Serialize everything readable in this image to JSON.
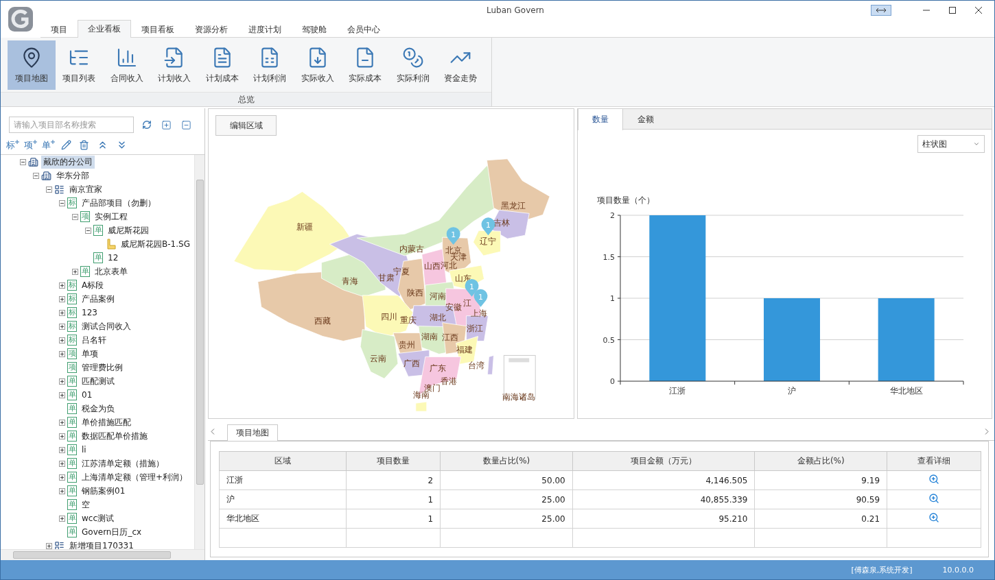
{
  "window": {
    "title": "Luban Govern"
  },
  "menu_tabs": [
    {
      "label": "项目",
      "selected": false
    },
    {
      "label": "企业看板",
      "selected": true
    },
    {
      "label": "项目看板",
      "selected": false
    },
    {
      "label": "资源分析",
      "selected": false
    },
    {
      "label": "进度计划",
      "selected": false
    },
    {
      "label": "驾驶舱",
      "selected": false
    },
    {
      "label": "会员中心",
      "selected": false
    }
  ],
  "ribbon": {
    "group": "总览",
    "buttons": [
      {
        "label": "项目地图",
        "kind": "map",
        "selected": true
      },
      {
        "label": "项目列表",
        "kind": "tree",
        "selected": false
      },
      {
        "label": "合同收入",
        "kind": "chart",
        "selected": false
      },
      {
        "label": "计划收入",
        "kind": "income",
        "selected": false
      },
      {
        "label": "计划成本",
        "kind": "cost",
        "selected": false
      },
      {
        "label": "计划利润",
        "kind": "sheet",
        "selected": false
      },
      {
        "label": "实际收入",
        "kind": "down",
        "selected": false
      },
      {
        "label": "实际成本",
        "kind": "doc",
        "selected": false
      },
      {
        "label": "实际利润",
        "kind": "coins",
        "selected": false
      },
      {
        "label": "资金走势",
        "kind": "trend",
        "selected": false
      }
    ]
  },
  "tree_panel": {
    "search": {
      "placeholder": "请输入项目部名称搜索"
    },
    "tools": [
      {
        "kind": "add",
        "glyph": "标"
      },
      {
        "kind": "add",
        "glyph": "项"
      },
      {
        "kind": "add",
        "glyph": "单"
      },
      {
        "kind": "edit"
      },
      {
        "kind": "delete"
      },
      {
        "kind": "collapse"
      },
      {
        "kind": "expand"
      }
    ],
    "tree": [
      {
        "label": "戴欣的分公司",
        "kind": "org",
        "expanded": true,
        "selected": true,
        "children": [
          {
            "label": "华东分部",
            "kind": "org",
            "expanded": true,
            "selected": false,
            "children": [
              {
                "label": "南京宜家",
                "kind": "list",
                "expanded": true,
                "selected": false,
                "children": [
                  {
                    "label": "产品部项目（勿删）",
                    "kind": "badge",
                    "badge": "标",
                    "expanded": true,
                    "selected": false,
                    "children": [
                      {
                        "label": "实例工程",
                        "kind": "badge",
                        "badge": "项",
                        "expanded": true,
                        "selected": false,
                        "children": [
                          {
                            "label": "威尼斯花园",
                            "kind": "badge",
                            "badge": "单",
                            "expanded": true,
                            "selected": false,
                            "children": [
                              {
                                "label": "威尼斯花园B-1.SG",
                                "kind": "file",
                                "selected": false
                              }
                            ]
                          },
                          {
                            "label": "12",
                            "kind": "badge",
                            "badge": "单",
                            "selected": false
                          }
                        ]
                      },
                      {
                        "label": "北京表单",
                        "kind": "badge",
                        "badge": "单",
                        "expanded": false,
                        "selected": false
                      }
                    ]
                  },
                  {
                    "label": "A标段",
                    "kind": "badge",
                    "badge": "标",
                    "expanded": false,
                    "selected": false
                  },
                  {
                    "label": "产品案例",
                    "kind": "badge",
                    "badge": "标",
                    "expanded": false,
                    "selected": false
                  },
                  {
                    "label": "123",
                    "kind": "badge",
                    "badge": "标",
                    "expanded": false,
                    "selected": false
                  },
                  {
                    "label": "测试合同收入",
                    "kind": "badge",
                    "badge": "标",
                    "expanded": false,
                    "selected": false
                  },
                  {
                    "label": "吕名轩",
                    "kind": "badge",
                    "badge": "标",
                    "expanded": false,
                    "selected": false
                  },
                  {
                    "label": "单项",
                    "kind": "badge",
                    "badge": "项",
                    "expanded": false,
                    "selected": false
                  },
                  {
                    "label": "管理费比例",
                    "kind": "badge",
                    "badge": "项",
                    "selected": false
                  },
                  {
                    "label": "匹配测试",
                    "kind": "badge",
                    "badge": "单",
                    "expanded": false,
                    "selected": false
                  },
                  {
                    "label": "01",
                    "kind": "badge",
                    "badge": "单",
                    "expanded": false,
                    "selected": false
                  },
                  {
                    "label": "税金为负",
                    "kind": "badge",
                    "badge": "单",
                    "selected": false
                  },
                  {
                    "label": "单价措施匹配",
                    "kind": "badge",
                    "badge": "单",
                    "expanded": false,
                    "selected": false
                  },
                  {
                    "label": "数据匹配单价措施",
                    "kind": "badge",
                    "badge": "单",
                    "expanded": false,
                    "selected": false
                  },
                  {
                    "label": "li",
                    "kind": "badge",
                    "badge": "单",
                    "expanded": false,
                    "selected": false
                  },
                  {
                    "label": "江苏清单定额（措施）",
                    "kind": "badge",
                    "badge": "单",
                    "expanded": false,
                    "selected": false
                  },
                  {
                    "label": "上海清单定额（管理+利润）",
                    "kind": "badge",
                    "badge": "单",
                    "expanded": false,
                    "selected": false
                  },
                  {
                    "label": "钢筋案例01",
                    "kind": "badge",
                    "badge": "单",
                    "expanded": false,
                    "selected": false
                  },
                  {
                    "label": "空",
                    "kind": "badge",
                    "badge": "单",
                    "selected": false
                  },
                  {
                    "label": "wcc测试",
                    "kind": "badge",
                    "badge": "单",
                    "expanded": false,
                    "selected": false
                  },
                  {
                    "label": "Govern日历_cx",
                    "kind": "badge",
                    "badge": "单",
                    "selected": false
                  }
                ]
              },
              {
                "label": "新增项目170331",
                "kind": "list",
                "expanded": false,
                "selected": false
              }
            ]
          }
        ]
      }
    ]
  },
  "map_panel": {
    "edit_button": "编辑区域",
    "regions": [
      "新疆",
      "西藏",
      "青海",
      "甘肃",
      "宁夏",
      "内蒙古",
      "黑龙江",
      "吉林",
      "辽宁",
      "北京",
      "天津",
      "山西",
      "河北",
      "山东",
      "陕西",
      "河南",
      "江",
      "安徽",
      "上海",
      "四川",
      "重庆",
      "湖北",
      "浙江",
      "湖南",
      "江西",
      "贵州",
      "福建",
      "云南",
      "广西",
      "广东",
      "台湾",
      "香港",
      "澳门",
      "海南",
      "南海诸岛"
    ],
    "markers": [
      {
        "count": "1"
      },
      {
        "count": "1"
      },
      {
        "count": "1"
      },
      {
        "count": "1"
      }
    ]
  },
  "chart_panel": {
    "tabs": [
      {
        "label": "数量",
        "selected": true
      },
      {
        "label": "金额",
        "selected": false
      }
    ],
    "chart_type": "柱状图",
    "chart_data": {
      "type": "bar",
      "ylabel": "项目数量（个）",
      "categories": [
        "江浙",
        "沪",
        "华北地区"
      ],
      "values": [
        2,
        1,
        1
      ],
      "ylim": [
        0,
        2
      ],
      "yticks": [
        0,
        0.5,
        1,
        1.5,
        2
      ],
      "grid": true
    }
  },
  "bottom_tabs": [
    {
      "label": "项目地图",
      "selected": true
    }
  ],
  "table": {
    "columns": [
      "区域",
      "项目数量",
      "数量占比(%)",
      "项目金额（万元）",
      "金额占比(%)",
      "查看详细"
    ],
    "rows": [
      [
        "江浙",
        "2",
        "50.00",
        "4,146.505",
        "9.19"
      ],
      [
        "沪",
        "1",
        "25.00",
        "40,855.339",
        "90.59"
      ],
      [
        "华北地区",
        "1",
        "25.00",
        "95.210",
        "0.21"
      ]
    ]
  },
  "status_bar": {
    "user": "[傅森泉,系统开发]",
    "version": "10.0.0.0"
  }
}
